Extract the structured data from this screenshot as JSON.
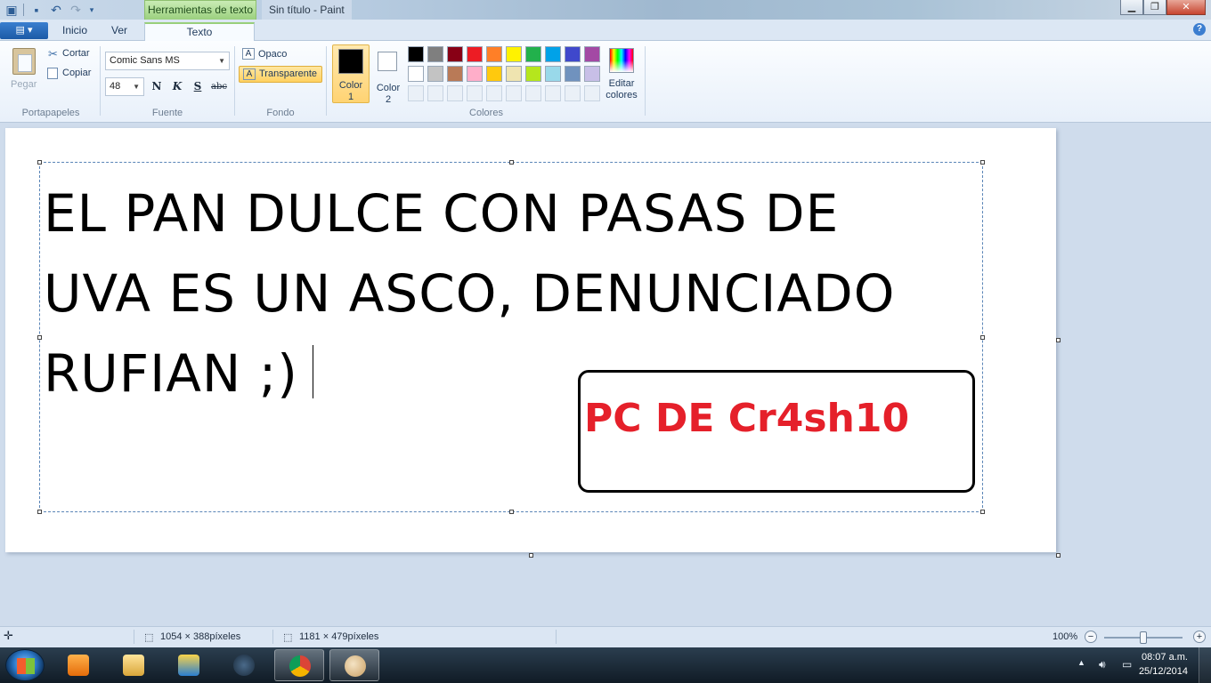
{
  "window": {
    "context_tab": "Herramientas de texto",
    "title": "Sin título - Paint",
    "minimize": "▁",
    "maximize": "❐",
    "close": "✕"
  },
  "tabs": {
    "app_menu": "▤ ▾",
    "items": [
      {
        "label": "Inicio"
      },
      {
        "label": "Ver"
      },
      {
        "label": "Texto"
      }
    ],
    "active": "Texto",
    "help": "?"
  },
  "ribbon": {
    "clipboard": {
      "paste_label": "Pegar",
      "cut_label": "Cortar",
      "copy_label": "Copiar",
      "group_label": "Portapapeles"
    },
    "font": {
      "family_value": "Comic Sans MS",
      "size_value": "48",
      "bold": "N",
      "italic": "K",
      "underline": "S",
      "strikethrough": "abc",
      "group_label": "Fuente"
    },
    "background": {
      "opaque_label": "Opaco",
      "transparent_label": "Transparente",
      "selected": "Transparente",
      "group_label": "Fondo"
    },
    "colors": {
      "color1_label_line1": "Color",
      "color1_label_line2": "1",
      "color1_value": "#000000",
      "color2_label_line1": "Color",
      "color2_label_line2": "2",
      "color2_value": "#ffffff",
      "edit_label_line1": "Editar",
      "edit_label_line2": "colores",
      "group_label": "Colores",
      "palette_row1": [
        "#000000",
        "#7f7f7f",
        "#880015",
        "#ed1c24",
        "#ff7f27",
        "#fff200",
        "#22b14c",
        "#00a2e8",
        "#3f48cc",
        "#a349a4"
      ],
      "palette_row2": [
        "#ffffff",
        "#c3c3c3",
        "#b97a57",
        "#ffaec9",
        "#ffc90e",
        "#efe4b0",
        "#b5e61d",
        "#99d9ea",
        "#7092be",
        "#c8bfe7"
      ]
    }
  },
  "canvas": {
    "text_lines": [
      "EL PAN DULCE CON PASAS DE",
      "UVA ES UN ASCO, DENUNCIADO",
      "RUFIAN ;)"
    ],
    "stamp_text": "PC DE Cr4sh10",
    "stamp_color": "#e5202a"
  },
  "statusbar": {
    "selection_size": "1054 × 388píxeles",
    "canvas_size": "1181 × 479píxeles",
    "zoom": "100%",
    "zoom_level": 1.0
  },
  "taskbar": {
    "time": "08:07 a.m.",
    "date": "25/12/2014"
  }
}
